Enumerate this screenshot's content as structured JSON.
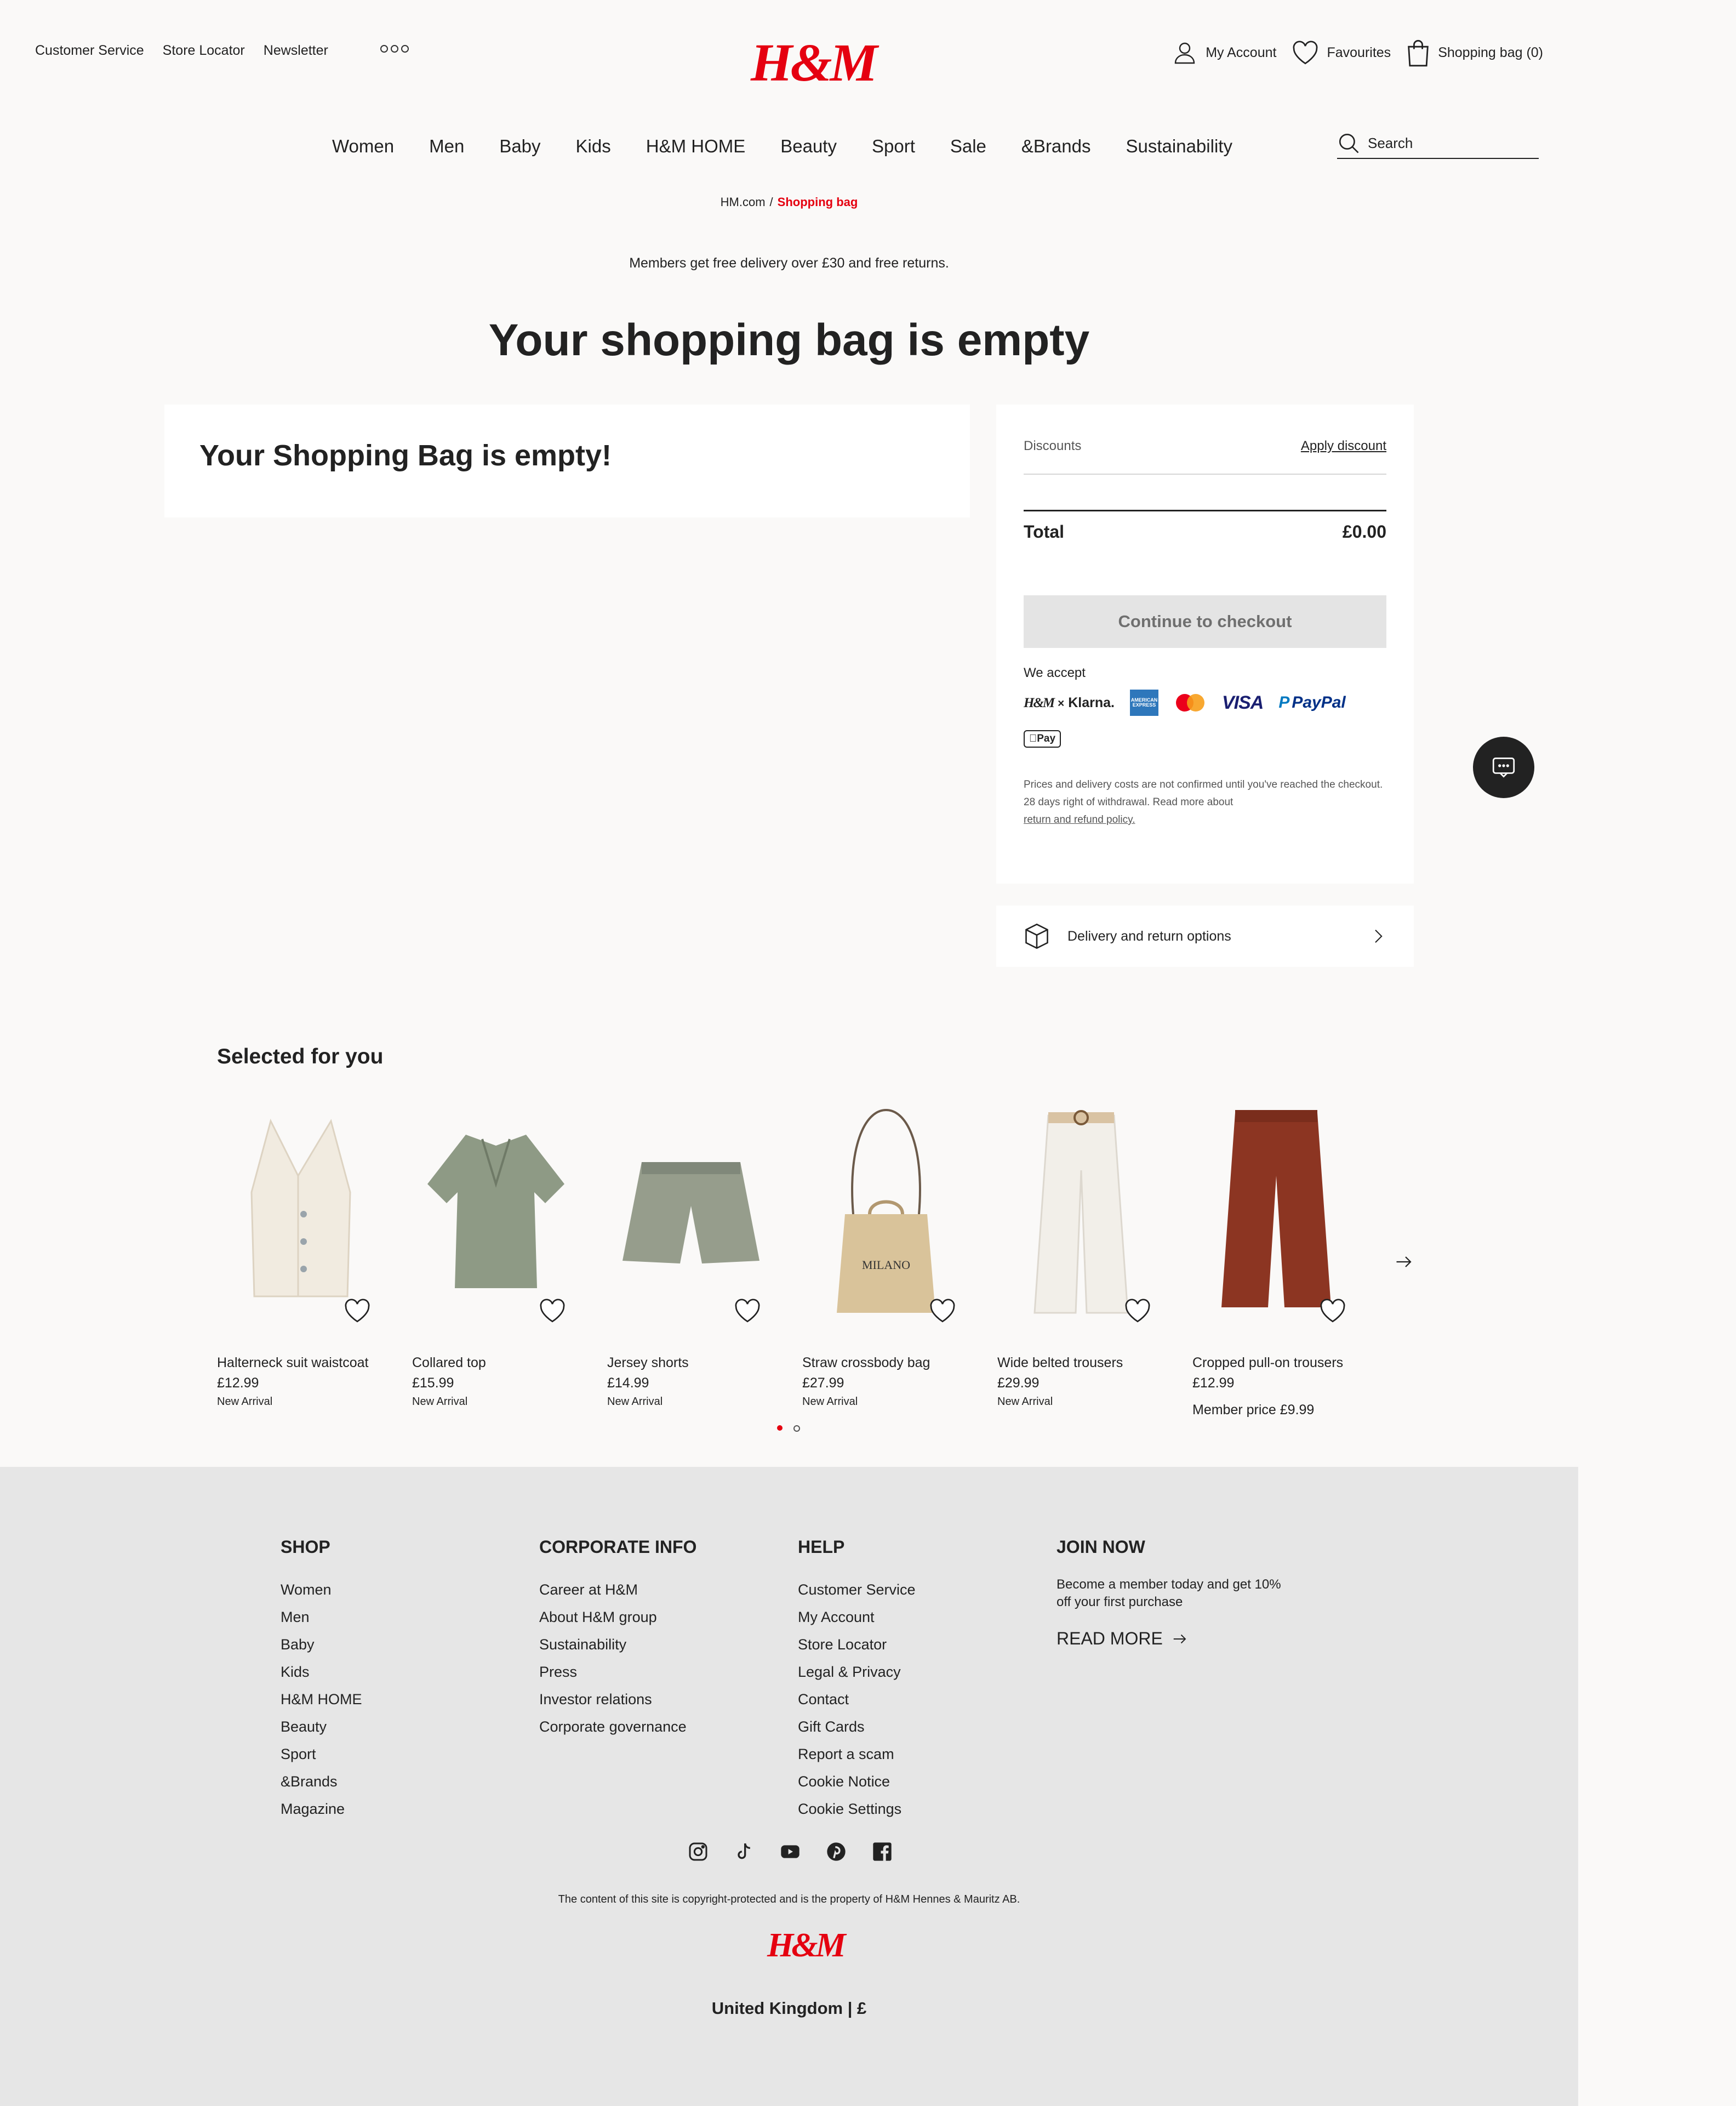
{
  "header": {
    "top_links": [
      "Customer Service",
      "Store Locator",
      "Newsletter"
    ],
    "logo": "H&M",
    "account": "My Account",
    "favourites": "Favourites",
    "bag": "Shopping bag (0)",
    "nav": [
      "Women",
      "Men",
      "Baby",
      "Kids",
      "H&M HOME",
      "Beauty",
      "Sport",
      "Sale",
      "&Brands",
      "Sustainability"
    ],
    "search_placeholder": "Search"
  },
  "breadcrumb": {
    "home": "HM.com",
    "separator": "/",
    "current": "Shopping bag"
  },
  "promo": "Members get free delivery over £30 and free returns.",
  "page_title": "Your shopping bag is empty",
  "empty_message": "Your Shopping Bag is empty!",
  "summary": {
    "discounts_label": "Discounts",
    "apply_discount": "Apply discount",
    "total_label": "Total",
    "total_value": "£0.00",
    "checkout_button": "Continue to checkout",
    "accept_label": "We accept",
    "payments": {
      "klarna_hm": "H&M",
      "klarna_x": "×",
      "klarna": "Klarna.",
      "amex": "AMERICAN EXPRESS",
      "visa": "VISA",
      "paypal": "PayPal",
      "applepay": "Pay"
    },
    "fine_print_1": "Prices and delivery costs are not confirmed until you've reached the checkout.",
    "fine_print_2": "28 days right of withdrawal. Read more about",
    "fine_print_link": "return and refund policy."
  },
  "delivery": {
    "label": "Delivery and return options"
  },
  "recommendations": {
    "title": "Selected for you",
    "products": [
      {
        "name": "Halterneck suit waistcoat",
        "price": "£12.99",
        "badge": "New Arrival",
        "image": "waistcoat",
        "color": "#f1ebe0"
      },
      {
        "name": "Collared top",
        "price": "£15.99",
        "badge": "New Arrival",
        "image": "polo-top",
        "color": "#8e9a85"
      },
      {
        "name": "Jersey shorts",
        "price": "£14.99",
        "badge": "New Arrival",
        "image": "shorts",
        "color": "#969d8c"
      },
      {
        "name": "Straw crossbody bag",
        "price": "£27.99",
        "badge": "New Arrival",
        "image": "straw-bag",
        "color": "#d9c39a",
        "bag_text": "MILANO"
      },
      {
        "name": "Wide belted trousers",
        "price": "£29.99",
        "badge": "New Arrival",
        "image": "white-trousers",
        "color": "#f2efe9"
      },
      {
        "name": "Cropped pull-on trousers",
        "price": "£12.99",
        "badge": "",
        "member_price": "Member price £9.99",
        "image": "rust-trousers",
        "color": "#8c3522"
      }
    ],
    "carousel_pages": 2,
    "active_page": 1
  },
  "footer": {
    "shop": {
      "title": "SHOP",
      "items": [
        "Women",
        "Men",
        "Baby",
        "Kids",
        "H&M HOME",
        "Beauty",
        "Sport",
        "&Brands",
        "Magazine"
      ]
    },
    "corporate": {
      "title": "CORPORATE INFO",
      "items": [
        "Career at H&M",
        "About H&M group",
        "Sustainability",
        "Press",
        "Investor relations",
        "Corporate governance"
      ]
    },
    "help": {
      "title": "HELP",
      "items": [
        "Customer Service",
        "My Account",
        "Store Locator",
        "Legal & Privacy",
        "Contact",
        "Gift Cards",
        "Report a scam",
        "Cookie Notice",
        "Cookie Settings"
      ]
    },
    "join": {
      "title": "JOIN NOW",
      "text": "Become a member today and get 10% off your first purchase",
      "read_more": "READ MORE"
    },
    "social_icons": [
      "instagram-icon",
      "tiktok-icon",
      "youtube-icon",
      "pinterest-icon",
      "facebook-icon"
    ],
    "copyright": "The content of this site is copyright-protected and is the property of H&M Hennes & Mauritz AB.",
    "logo": "H&M",
    "country": "United Kingdom | £"
  },
  "colors": {
    "brand_red": "#e50010",
    "footer_bg": "#e6e6e6",
    "page_bg": "#faf9f8",
    "disabled_button": "#e4e4e4"
  }
}
